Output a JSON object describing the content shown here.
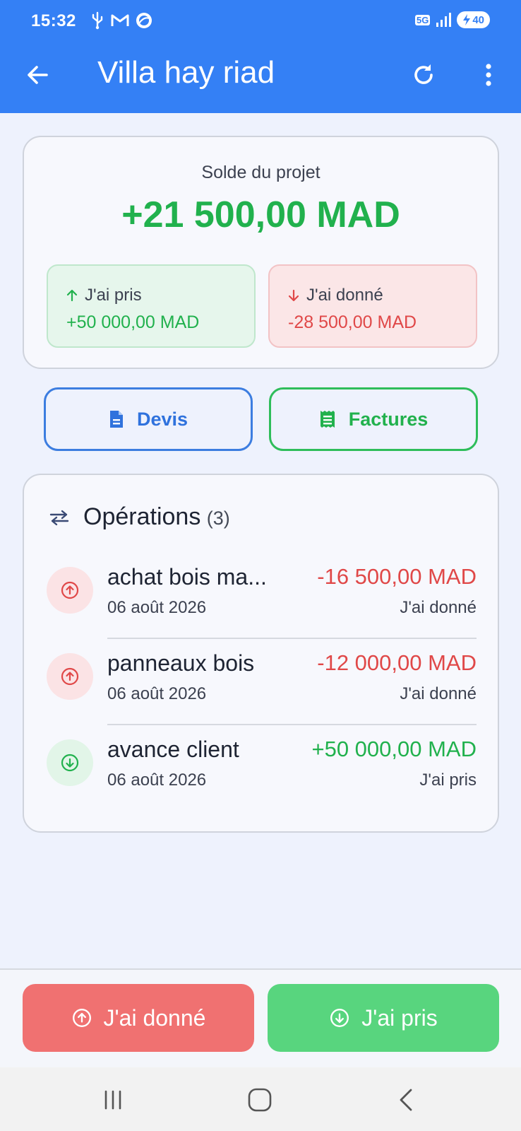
{
  "status_bar": {
    "time": "15:32",
    "network": "5G",
    "battery": "40"
  },
  "app_bar": {
    "title": "Villa hay riad"
  },
  "balance": {
    "label": "Solde du projet",
    "value": "+21 500,00 MAD",
    "took": {
      "label": "J'ai pris",
      "value": "+50 000,00 MAD"
    },
    "gave": {
      "label": "J'ai donné",
      "value": "-28 500,00 MAD"
    }
  },
  "actions": {
    "devis_label": "Devis",
    "factures_label": "Factures"
  },
  "operations": {
    "title": "Opérations",
    "count": "(3)",
    "items": [
      {
        "name": "achat bois ma...",
        "date": "06 août 2026",
        "amount": "-16 500,00 MAD",
        "type": "J'ai donné",
        "direction": "out"
      },
      {
        "name": "panneaux bois",
        "date": "06 août 2026",
        "amount": "-12 000,00 MAD",
        "type": "J'ai donné",
        "direction": "out"
      },
      {
        "name": "avance client",
        "date": "06 août 2026",
        "amount": "+50 000,00 MAD",
        "type": "J'ai pris",
        "direction": "in"
      }
    ]
  },
  "bottom_actions": {
    "gave_label": "J'ai donné",
    "took_label": "J'ai pris"
  },
  "colors": {
    "primary": "#3480f5",
    "positive": "#21b14d",
    "negative": "#e04848",
    "gave_button": "#f07171",
    "took_button": "#58d57e"
  }
}
